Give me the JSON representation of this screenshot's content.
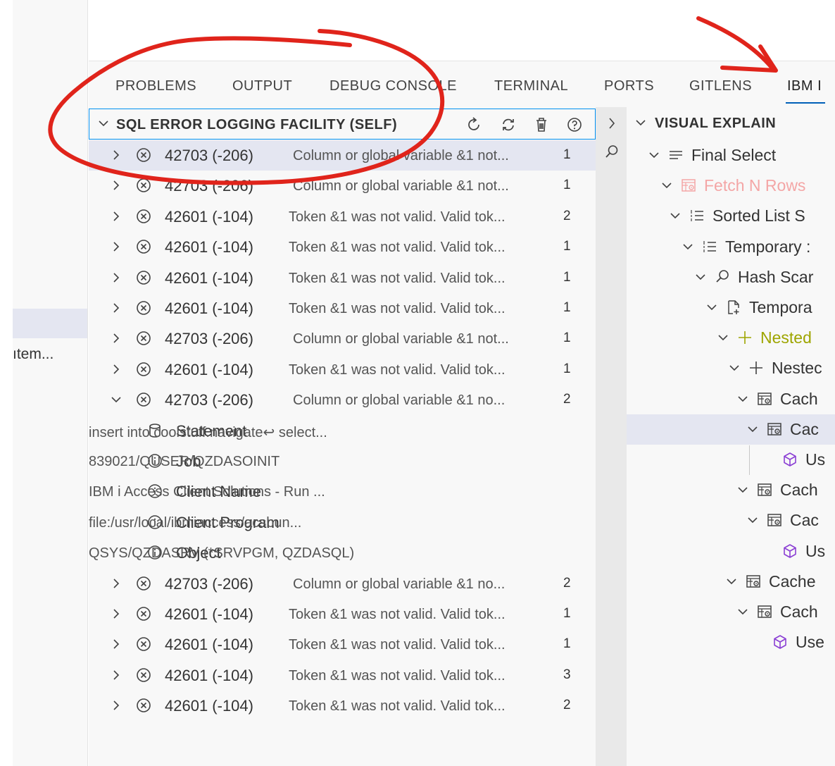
{
  "left_sidebar": {
    "truncated_item": "ıtem..."
  },
  "panel": {
    "tabs": [
      {
        "label": "PROBLEMS"
      },
      {
        "label": "OUTPUT"
      },
      {
        "label": "DEBUG CONSOLE"
      },
      {
        "label": "TERMINAL"
      },
      {
        "label": "PORTS"
      },
      {
        "label": "GITLENS"
      },
      {
        "label": "IBM I"
      }
    ],
    "active_tab": "IBM I"
  },
  "sql_error_view": {
    "title": "SQL ERROR LOGGING FACILITY (SELF)",
    "header_actions": [
      {
        "name": "refresh-icon"
      },
      {
        "name": "sync-icon"
      },
      {
        "name": "trash-icon"
      },
      {
        "name": "help-icon"
      }
    ],
    "rows": [
      {
        "code": "42703 (-206)",
        "message": "Column or global variable &1 not...",
        "count": "1"
      },
      {
        "code": "42703 (-206)",
        "message": "Column or global variable &1 not...",
        "count": "1"
      },
      {
        "code": "42601 (-104)",
        "message": "Token &1 was not valid. Valid tok...",
        "count": "2"
      },
      {
        "code": "42601 (-104)",
        "message": "Token &1 was not valid. Valid tok...",
        "count": "1"
      },
      {
        "code": "42601 (-104)",
        "message": "Token &1 was not valid. Valid tok...",
        "count": "1"
      },
      {
        "code": "42601 (-104)",
        "message": "Token &1 was not valid. Valid tok...",
        "count": "1"
      },
      {
        "code": "42703 (-206)",
        "message": "Column or global variable &1 not...",
        "count": "1"
      },
      {
        "code": "42601 (-104)",
        "message": "Token &1 was not valid. Valid tok...",
        "count": "1"
      },
      {
        "code": "42703 (-206)",
        "message": "Column or global variable &1 no...",
        "count": "2"
      }
    ],
    "details": [
      {
        "icon": "database-icon",
        "label": "Statement",
        "value": "insert into coolstuff.navigate↩ select..."
      },
      {
        "icon": "info-icon",
        "label": "Job",
        "value": "839021/QUSER/QZDASOINIT"
      },
      {
        "icon": "info-icon",
        "label": "Client Name",
        "value": "IBM i Access Client Solutions - Run ..."
      },
      {
        "icon": "info-icon",
        "label": "Client Program",
        "value": "file:/usr/local/ibmiaccess/acsbun..."
      },
      {
        "icon": "info-icon",
        "label": "Object",
        "value": "QSYS/QZDASRV (*SRVPGM, QZDASQL)"
      }
    ],
    "rows_after": [
      {
        "code": "42703 (-206)",
        "message": "Column or global variable &1 no...",
        "count": "2"
      },
      {
        "code": "42601 (-104)",
        "message": "Token &1 was not valid. Valid tok...",
        "count": "1"
      },
      {
        "code": "42601 (-104)",
        "message": "Token &1 was not valid. Valid tok...",
        "count": "1"
      },
      {
        "code": "42601 (-104)",
        "message": "Token &1 was not valid. Valid tok...",
        "count": "3"
      },
      {
        "code": "42601 (-104)",
        "message": "Token &1 was not valid. Valid tok...",
        "count": "2"
      }
    ]
  },
  "visual_explain": {
    "title": "VISUAL EXPLAIN",
    "nodes": [
      {
        "label": "Final Select",
        "icon": "lines-icon",
        "color": "#333333"
      },
      {
        "label": "Fetch N Rows",
        "icon": "table-gear-icon",
        "color": "#f4a6a6"
      },
      {
        "label": "Sorted List S",
        "icon": "list-icon",
        "color": "#333333"
      },
      {
        "label": "Temporary :",
        "icon": "list-icon",
        "color": "#333333"
      },
      {
        "label": "Hash Scar",
        "icon": "search-icon",
        "color": "#333333"
      },
      {
        "label": "Tempora",
        "icon": "new-file-icon",
        "color": "#333333"
      },
      {
        "label": "Nested",
        "icon": "plus-icon",
        "color": "#9ea500"
      },
      {
        "label": "Nestec",
        "icon": "plus-icon",
        "color": "#333333"
      },
      {
        "label": "Cach",
        "icon": "table-gear-icon",
        "color": "#333333"
      },
      {
        "label": "Cac",
        "icon": "table-gear-icon",
        "color": "#333333"
      },
      {
        "label": "Us",
        "icon": "cube-icon",
        "color": "#333333"
      },
      {
        "label": "Cach",
        "icon": "table-gear-icon",
        "color": "#333333"
      },
      {
        "label": "Cac",
        "icon": "table-gear-icon",
        "color": "#333333"
      },
      {
        "label": "Us",
        "icon": "cube-icon",
        "color": "#333333"
      },
      {
        "label": "Cache",
        "icon": "table-gear-icon",
        "color": "#333333"
      },
      {
        "label": "Cach",
        "icon": "table-gear-icon",
        "color": "#333333"
      },
      {
        "label": "Use",
        "icon": "cube-icon",
        "color": "#333333"
      }
    ]
  },
  "colors": {
    "accent": "#005fb8",
    "focus_border": "#0090f1",
    "selection": "#e4e6f1",
    "annotation": "#e0241b",
    "cube": "#8b3fd4"
  }
}
